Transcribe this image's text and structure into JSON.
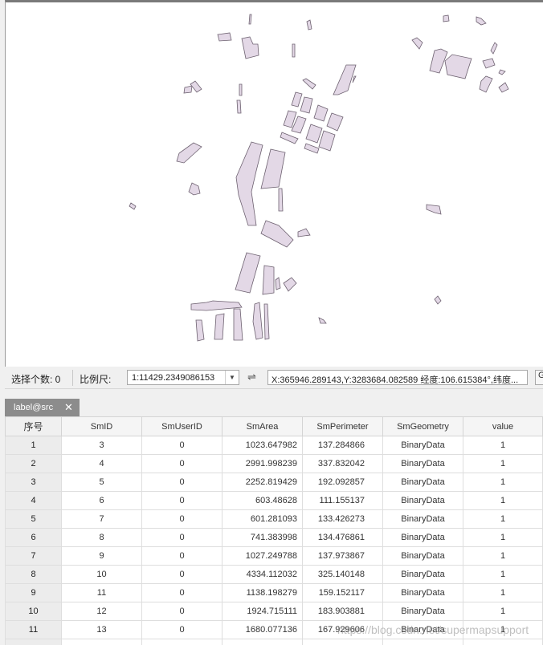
{
  "status_bar": {
    "selection_label": "选择个数: 0",
    "scale_label": "比例尺:",
    "scale_value": "1:11429.2349086153",
    "coordinates": "X:365946.289143,Y:3283684.082589   经度:106.615384°,纬度...",
    "edge_button": "G"
  },
  "tab": {
    "label": "label@src"
  },
  "table": {
    "columns": [
      "序号",
      "SmID",
      "SmUserID",
      "SmArea",
      "SmPerimeter",
      "SmGeometry",
      "value"
    ],
    "rows": [
      [
        "1",
        "3",
        "0",
        "1023.647982",
        "137.284866",
        "BinaryData",
        "1"
      ],
      [
        "2",
        "4",
        "0",
        "2991.998239",
        "337.832042",
        "BinaryData",
        "1"
      ],
      [
        "3",
        "5",
        "0",
        "2252.819429",
        "192.092857",
        "BinaryData",
        "1"
      ],
      [
        "4",
        "6",
        "0",
        "603.48628",
        "111.155137",
        "BinaryData",
        "1"
      ],
      [
        "5",
        "7",
        "0",
        "601.281093",
        "133.426273",
        "BinaryData",
        "1"
      ],
      [
        "6",
        "8",
        "0",
        "741.383998",
        "134.476861",
        "BinaryData",
        "1"
      ],
      [
        "7",
        "9",
        "0",
        "1027.249788",
        "137.973867",
        "BinaryData",
        "1"
      ],
      [
        "8",
        "10",
        "0",
        "4334.112032",
        "325.140148",
        "BinaryData",
        "1"
      ],
      [
        "9",
        "11",
        "0",
        "1138.198279",
        "159.152117",
        "BinaryData",
        "1"
      ],
      [
        "10",
        "12",
        "0",
        "1924.715111",
        "183.903881",
        "BinaryData",
        "1"
      ],
      [
        "11",
        "13",
        "0",
        "1680.077136",
        "167.929606",
        "BinaryData",
        "1"
      ],
      [
        "",
        "",
        "",
        "",
        "",
        "",
        ""
      ]
    ]
  },
  "watermark": "https://blog.csdn.net/supermapsupport",
  "colors": {
    "polygon_fill": "#e3d8e6",
    "polygon_stroke": "#6d6170",
    "tab_bg": "#8c8c8c"
  },
  "icons": {
    "swap": "swap-arrows-icon",
    "dropdown": "chevron-down-icon",
    "close": "close-icon"
  }
}
